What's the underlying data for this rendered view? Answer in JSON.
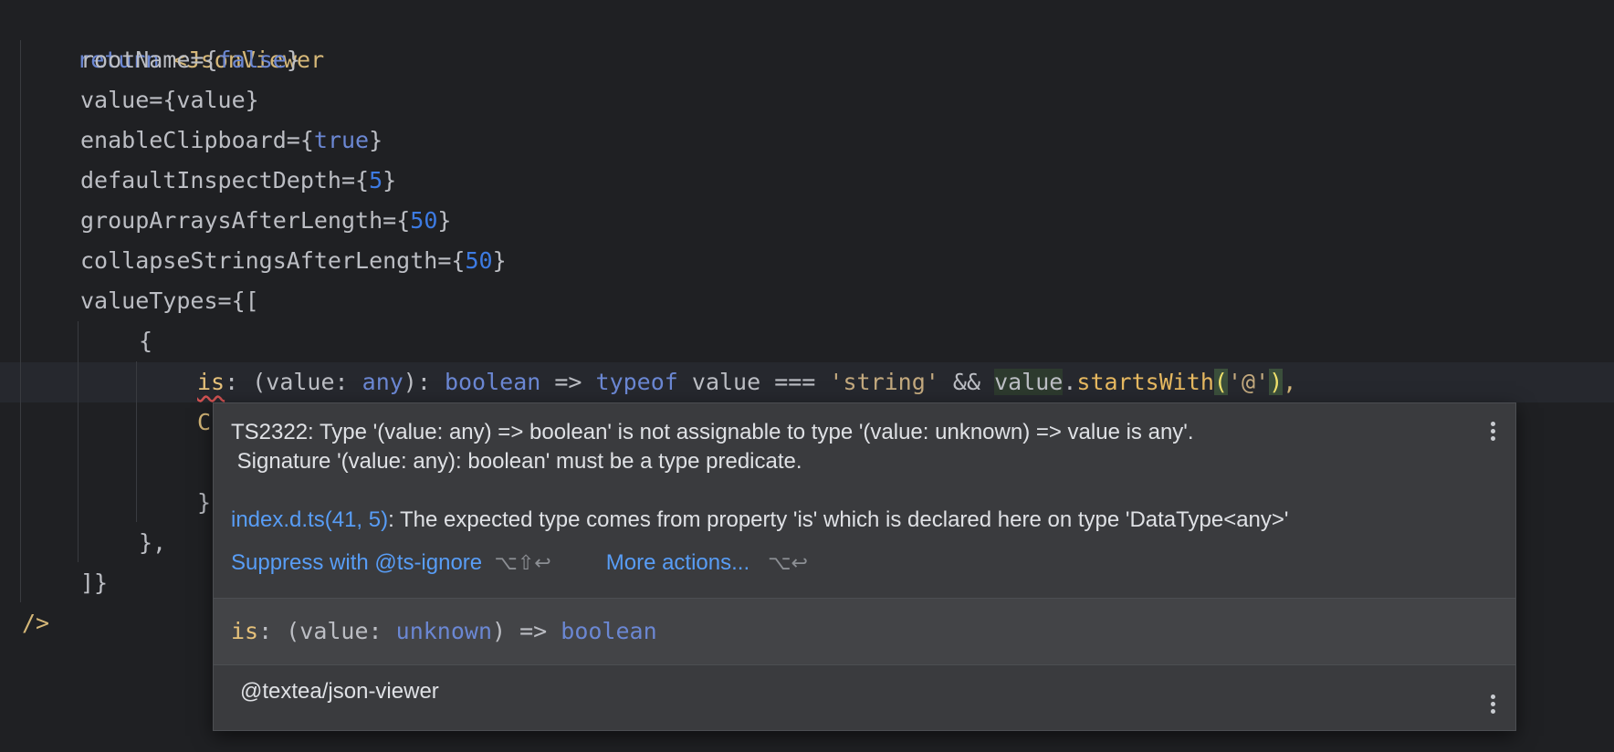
{
  "code": {
    "l1": {
      "kw": "return",
      "tag": "<JsonViewer"
    },
    "l2": {
      "attr": "rootName",
      "eq": "=",
      "open": "{",
      "val": "false",
      "close": "}"
    },
    "l3": {
      "attr": "value",
      "eq": "=",
      "open": "{",
      "val": "value",
      "close": "}"
    },
    "l4": {
      "attr": "enableClipboard",
      "eq": "=",
      "open": "{",
      "val": "true",
      "close": "}"
    },
    "l5": {
      "attr": "defaultInspectDepth",
      "eq": "=",
      "open": "{",
      "val": "5",
      "close": "}"
    },
    "l6": {
      "attr": "groupArraysAfterLength",
      "eq": "=",
      "open": "{",
      "val": "50",
      "close": "}"
    },
    "l7": {
      "attr": "collapseStringsAfterLength",
      "eq": "=",
      "open": "{",
      "val": "50",
      "close": "}"
    },
    "l8": {
      "attr": "valueTypes",
      "eq": "=",
      "open": "{["
    },
    "l9": {
      "text": "{"
    },
    "l10": {
      "prop": "is",
      "p1": ": (",
      "param": "value",
      "p2": ": ",
      "t_any": "any",
      "p3": "): ",
      "t_bool": "boolean",
      "p4": " => ",
      "kw_typeof": "typeof",
      "p5": " value === ",
      "str": "'string'",
      "p6": " && ",
      "val": "value",
      "dot": ".",
      "fn": "startsWith",
      "lp": "(",
      "arg": "'@'",
      "rp": ")",
      "comma": ","
    },
    "l11": {
      "text": "C"
    },
    "l13": {
      "text": "}"
    },
    "l14": {
      "text": "},"
    },
    "l15": {
      "text": "]}"
    },
    "l16": {
      "text": "/>"
    }
  },
  "popup": {
    "error_line1": "TS2322: Type '(value: any) => boolean' is not assignable to type '(value: unknown) => value is any'.",
    "error_line2": " Signature '(value: any): boolean' must be a type predicate.",
    "source_link": "index.d.ts(41, 5)",
    "source_text": ": The expected type comes from property 'is' which is declared here on type 'DataType<any>'",
    "suppress_label": "Suppress with @ts-ignore",
    "suppress_shortcut": "⌥⇧↩",
    "more_label": "More actions...",
    "more_shortcut": "⌥↩",
    "sig": {
      "prop": "is",
      "p1": ": (",
      "param": "value",
      "p2": ": ",
      "type": "unknown",
      "p3": ") => ",
      "ret": "boolean"
    },
    "package": "@textea/json-viewer"
  }
}
